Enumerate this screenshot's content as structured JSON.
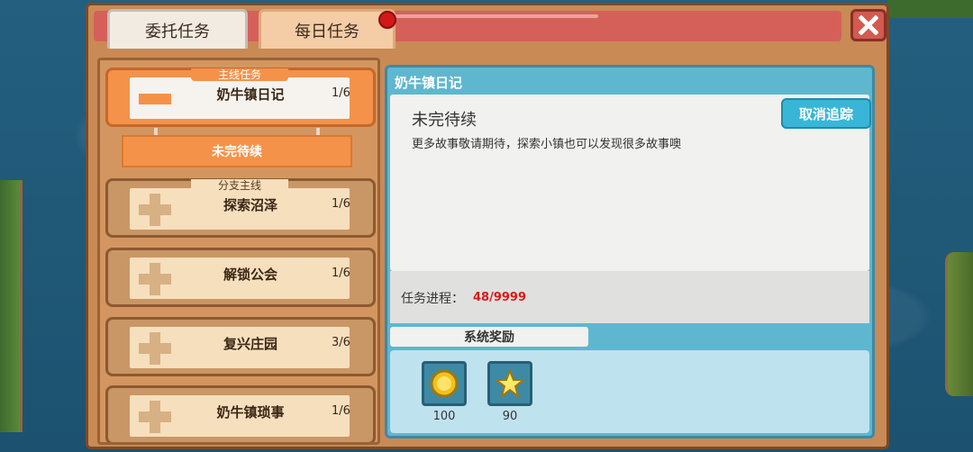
{
  "tabs": [
    {
      "label": "委托任务"
    },
    {
      "label": "每日任务"
    }
  ],
  "quest_list": {
    "active": {
      "tag": "主线任务",
      "name": "奶牛镇日记",
      "count": "1/6",
      "sub_item": "未完待续"
    },
    "entries": [
      {
        "tag": "分支主线",
        "name": "探索沼泽",
        "count": "1/6"
      },
      {
        "tag": "",
        "name": "解锁公会",
        "count": "1/6"
      },
      {
        "tag": "",
        "name": "复兴庄园",
        "count": "3/6"
      },
      {
        "tag": "",
        "name": "奶牛镇琐事",
        "count": "1/6"
      }
    ]
  },
  "detail": {
    "title": "奶牛镇日记",
    "status": "未完待续",
    "description": "更多故事敬请期待，探索小镇也可以发现很多故事噢",
    "cancel_button": "取消追踪",
    "progress_label": "任务进程：",
    "progress_value": "48/9999",
    "rewards_title": "系统奖励",
    "rewards": [
      {
        "icon": "coin-icon",
        "quantity": "100"
      },
      {
        "icon": "star-icon",
        "quantity": "90"
      }
    ]
  },
  "colors": {
    "accent": "#f4924a",
    "progress": "#d61b1b",
    "panel": "#c98a55",
    "detail": "#5fb7cf"
  }
}
